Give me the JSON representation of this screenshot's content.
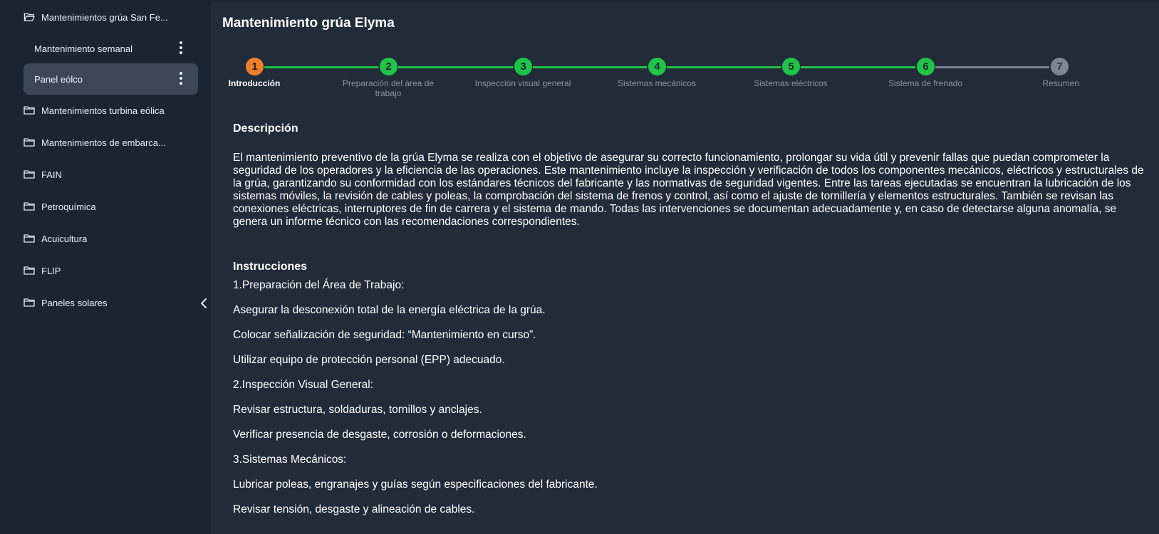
{
  "sidebar": {
    "items": [
      {
        "label": "Mantenimientos grúa San Fe...",
        "icon": "folder-open-icon"
      },
      {
        "label": "Mantenimientos turbina eólica",
        "icon": "folder-icon"
      },
      {
        "label": "Mantenimientos de embarca...",
        "icon": "folder-icon"
      },
      {
        "label": "FAIN",
        "icon": "folder-icon"
      },
      {
        "label": "Petroquímica",
        "icon": "folder-icon"
      },
      {
        "label": "Acuicultura",
        "icon": "folder-icon"
      },
      {
        "label": "FLIP",
        "icon": "folder-icon"
      },
      {
        "label": "Paneles solares",
        "icon": "folder-icon"
      }
    ],
    "subitems": [
      {
        "label": "Mantenimiento semanal"
      },
      {
        "label": "Panel eólco",
        "active": true
      }
    ]
  },
  "main": {
    "title": "Mantenimiento grúa Elyma",
    "steps": [
      {
        "number": "1",
        "label": "Introducción",
        "status": "current"
      },
      {
        "number": "2",
        "label": "Preparación del área de trabajo",
        "status": "done"
      },
      {
        "number": "3",
        "label": "Inspección visual general",
        "status": "done"
      },
      {
        "number": "4",
        "label": "Sistemas mecánicos",
        "status": "done"
      },
      {
        "number": "5",
        "label": "Sistemas eléctricos",
        "status": "done"
      },
      {
        "number": "6",
        "label": "Sistema de frenado",
        "status": "done"
      },
      {
        "number": "7",
        "label": "Resumen",
        "status": "pending"
      }
    ],
    "description_title": "Descripción",
    "description": "El mantenimiento preventivo de la grúa Elyma se realiza con el objetivo de asegurar su correcto funcionamiento, prolongar su vida útil y prevenir fallas que puedan comprometer la seguridad de los operadores y la eficiencia de las operaciones. Este mantenimiento incluye la inspección y verificación de todos los componentes mecánicos, eléctricos y estructurales de la grúa, garantizando su conformidad con los estándares técnicos del fabricante y las normativas de seguridad vigentes. Entre las tareas ejecutadas se encuentran la lubricación de los sistemas móviles, la revisión de cables y poleas, la comprobación del sistema de frenos y control, así como el ajuste de tornillería y elementos estructurales. También se revisan las conexiones eléctricas, interruptores de fin de carrera y el sistema de mando. Todas las intervenciones se documentan adecuadamente y, en caso de detectarse alguna anomalía, se genera un informe técnico con las recomendaciones correspondientes.",
    "instructions_title": "Instrucciones",
    "instructions": [
      "1.Preparación del Área de Trabajo:",
      "Asegurar la desconexión total de la energía eléctrica de la grúa.",
      "Colocar señalización de seguridad: “Mantenimiento en curso”.",
      "Utilizar equipo de protección personal (EPP) adecuado.",
      "2.Inspección Visual General:",
      "Revisar estructura, soldaduras, tornillos y anclajes.",
      "Verificar presencia de desgaste, corrosión o deformaciones.",
      "3.Sistemas Mecánicos:",
      "Lubricar poleas, engranajes y guías según especificaciones del fabricante.",
      "Revisar tensión, desgaste y alineación de cables."
    ]
  },
  "colors": {
    "current": "#ef7f2a",
    "done": "#1ec447",
    "pending": "#7d8590",
    "active_item": "#3b4757"
  }
}
